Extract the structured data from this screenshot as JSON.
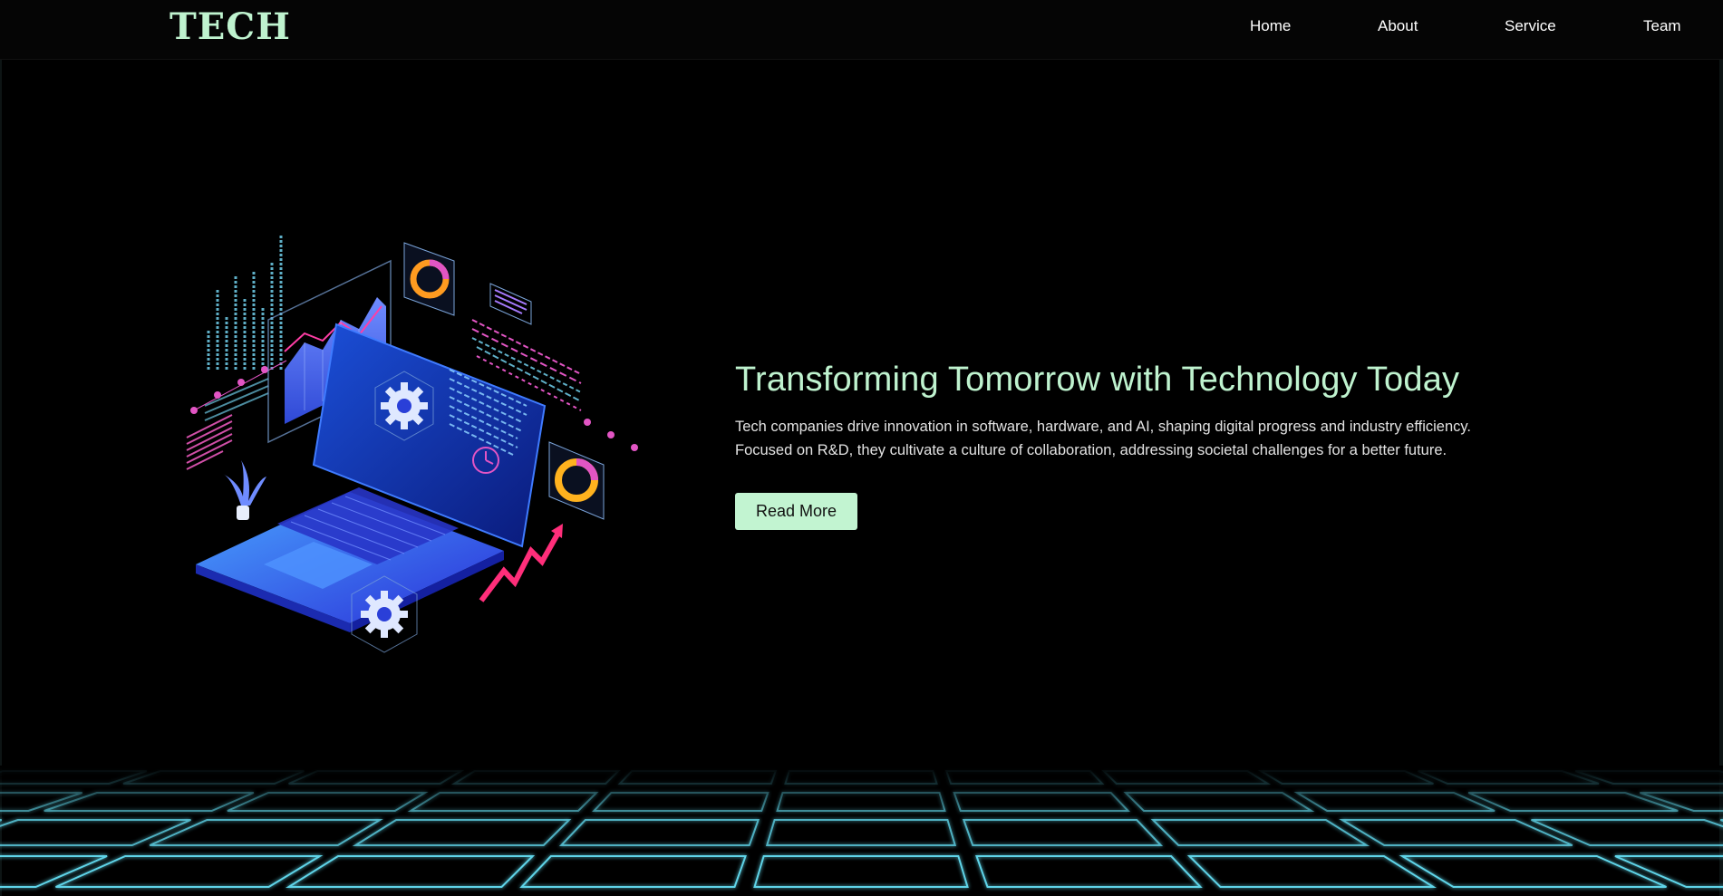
{
  "header": {
    "logo": "TECH",
    "nav": [
      {
        "label": "Home"
      },
      {
        "label": "About"
      },
      {
        "label": "Service"
      },
      {
        "label": "Team"
      }
    ]
  },
  "hero": {
    "title": "Transforming Tomorrow with Technology Today",
    "description_line1": "Tech companies drive innovation in software, hardware, and AI, shaping digital progress and industry efficiency.",
    "description_line2": "Focused on R&D, they cultivate a culture of collaboration, addressing societal challenges for a better future.",
    "button_label": "Read More",
    "illustration_icon": "isometric-laptop-tech-illustration"
  },
  "colors": {
    "accent": "#bff3cf",
    "button_bg": "#c2f4d1",
    "background": "#000000",
    "grid_glow": "#5fd4e8"
  }
}
